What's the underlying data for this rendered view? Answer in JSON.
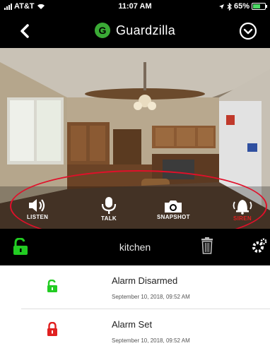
{
  "status_bar": {
    "carrier": "AT&T",
    "time": "11:07 AM",
    "battery": "65%",
    "battery_level": 0.65
  },
  "nav": {
    "back_icon": "chevron-left-icon",
    "brand_letter": "G",
    "brand_name": "Guardzilla",
    "brand_color": "#3aaa35",
    "menu_icon": "chevron-down-circle-icon"
  },
  "camera": {
    "controls": {
      "listen": "LISTEN",
      "talk": "TALK",
      "snapshot": "SNAPSHOT",
      "siren": "SIREN"
    },
    "highlight_color": "#e0102a"
  },
  "device": {
    "name": "kitchen",
    "lock_color": "#22cc22"
  },
  "events": [
    {
      "title": "Alarm Disarmed",
      "time": "September 10, 2018, 09:52 AM",
      "icon": "unlocked-padlock-icon",
      "color": "#22cc22"
    },
    {
      "title": "Alarm Set",
      "time": "September 10, 2018, 09:52 AM",
      "icon": "locked-padlock-icon",
      "color": "#e02020"
    }
  ]
}
